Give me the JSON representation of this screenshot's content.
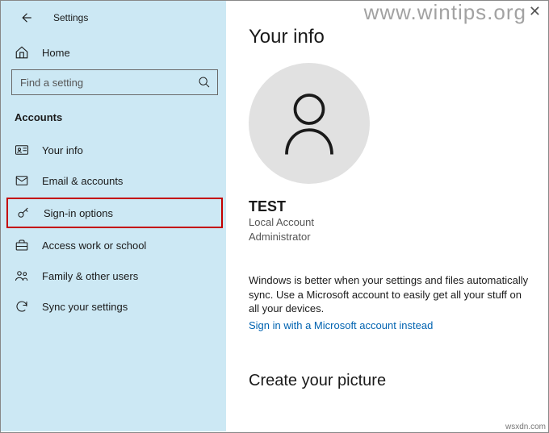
{
  "header": {
    "app_title": "Settings"
  },
  "sidebar": {
    "home_label": "Home",
    "search_placeholder": "Find a setting",
    "section_label": "Accounts",
    "items": [
      {
        "label": "Your info"
      },
      {
        "label": "Email & accounts"
      },
      {
        "label": "Sign-in options"
      },
      {
        "label": "Access work or school"
      },
      {
        "label": "Family & other users"
      },
      {
        "label": "Sync your settings"
      }
    ]
  },
  "main": {
    "page_title": "Your info",
    "username": "TEST",
    "account_type": "Local Account",
    "role": "Administrator",
    "sync_text": "Windows is better when your settings and files automatically sync. Use a Microsoft account to easily get all your stuff on all your devices.",
    "signin_link": "Sign in with a Microsoft account instead",
    "picture_title": "Create your picture"
  },
  "watermark": "www.wintips.org",
  "footer_credit": "wsxdn.com"
}
